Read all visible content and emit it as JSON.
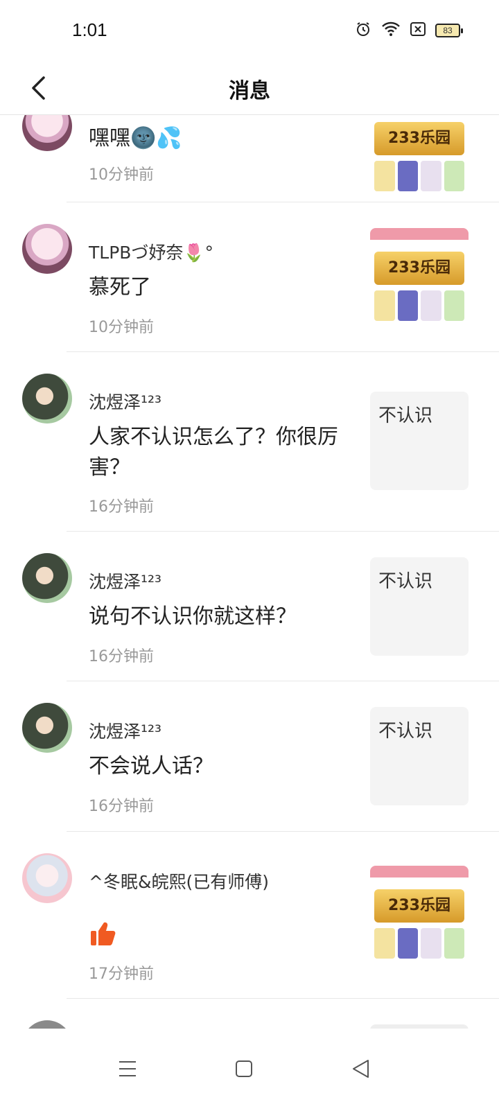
{
  "status_bar": {
    "time": "1:01",
    "battery": "83"
  },
  "header": {
    "title": "消息"
  },
  "messages": [
    {
      "name": "",
      "text": "嘿嘿🌚💦",
      "time": "10分钟前",
      "thumb_type": "image",
      "thumb_text": "233乐园"
    },
    {
      "name": "TLPBづ妤奈🌷°",
      "text": "慕死了",
      "time": "10分钟前",
      "thumb_type": "image",
      "thumb_text": "233乐园"
    },
    {
      "name": "沈煜泽¹²³",
      "text": "人家不认识怎么了？你很厉害？",
      "time": "16分钟前",
      "thumb_type": "text",
      "thumb_text": "不认识"
    },
    {
      "name": "沈煜泽¹²³",
      "text": "说句不认识你就这样？",
      "time": "16分钟前",
      "thumb_type": "text",
      "thumb_text": "不认识"
    },
    {
      "name": "沈煜泽¹²³",
      "text": "不会说人话？",
      "time": "16分钟前",
      "thumb_type": "text",
      "thumb_text": "不认识"
    },
    {
      "name": "^冬眠&皖熙(已有师傅)",
      "text": "",
      "time": "17分钟前",
      "thumb_type": "image",
      "thumb_text": "233乐园"
    }
  ],
  "colors": {
    "like": "#f05a22",
    "divider": "#e8e8e8",
    "time": "#999999"
  }
}
